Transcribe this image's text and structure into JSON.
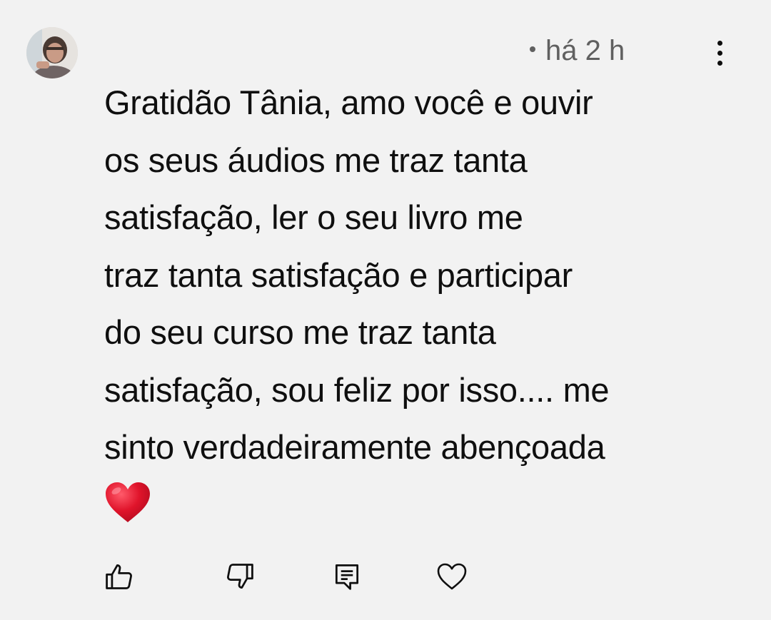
{
  "comment": {
    "timestamp": "há 2 h",
    "lines": [
      "Gratidão Tânia, amo você e ouvir",
      "os seus áudios me traz tanta",
      "satisfação, ler o seu livro me",
      "traz tanta satisfação e participar",
      "do seu curso me traz tanta",
      "satisfação, sou feliz por isso.... me",
      "sinto verdadeiramente abençoada"
    ],
    "emoji": "red-heart-emoji"
  },
  "actions": {
    "like_icon": "thumbs-up-icon",
    "dislike_icon": "thumbs-down-icon",
    "reply_icon": "comment-reply-icon",
    "heart_icon": "heart-outline-icon"
  },
  "colors": {
    "background": "#f2f2f2",
    "text": "#0f0f0f",
    "secondary_text": "#606060",
    "heart": "#e0142b"
  }
}
